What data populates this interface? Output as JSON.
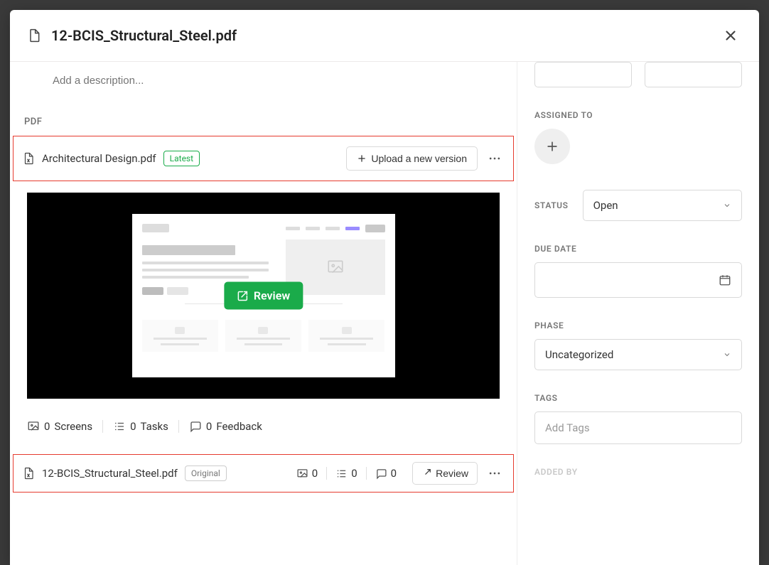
{
  "title": "12-BCIS_Structural_Steel.pdf",
  "description_placeholder": "Add a description...",
  "section_pdf_label": "PDF",
  "version_current": {
    "filename": "Architectural Design.pdf",
    "badge": "Latest",
    "upload_button": "Upload a new version",
    "review_button": "Review"
  },
  "stats": {
    "screens": {
      "count": "0",
      "label": "Screens"
    },
    "tasks": {
      "count": "0",
      "label": "Tasks"
    },
    "feedback": {
      "count": "0",
      "label": "Feedback"
    }
  },
  "version_prev": {
    "filename": "12-BCIS_Structural_Steel.pdf",
    "badge": "Original",
    "screens": "0",
    "tasks": "0",
    "feedback": "0",
    "review_button": "Review"
  },
  "sidebar": {
    "assigned_to_label": "ASSIGNED TO",
    "status_label": "STATUS",
    "status_value": "Open",
    "due_date_label": "DUE DATE",
    "phase_label": "PHASE",
    "phase_value": "Uncategorized",
    "tags_label": "TAGS",
    "tags_placeholder": "Add Tags",
    "added_by_label": "ADDED BY"
  }
}
